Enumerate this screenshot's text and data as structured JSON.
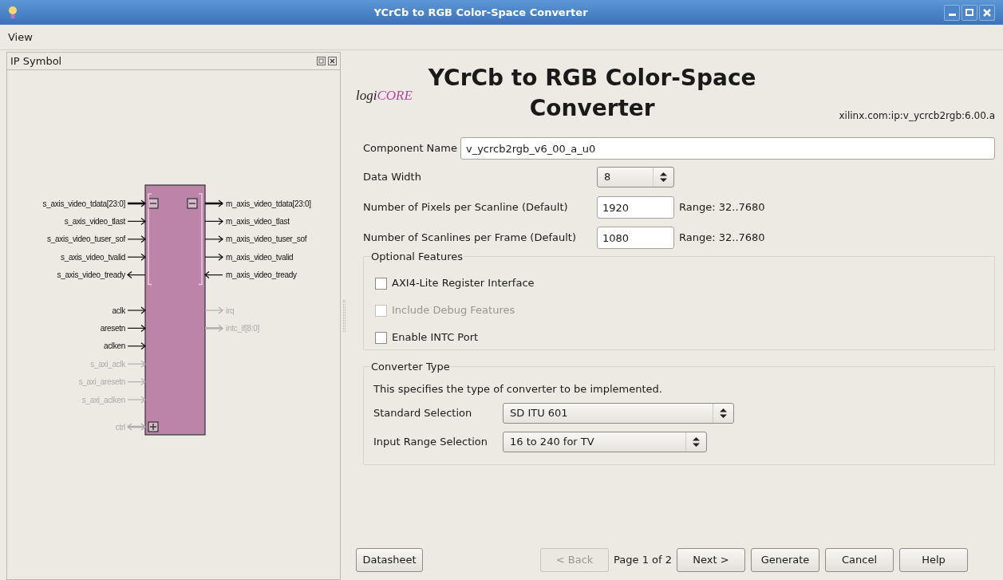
{
  "window": {
    "title": "YCrCb to RGB Color-Space Converter"
  },
  "menu": [
    {
      "label": "View"
    }
  ],
  "ip_symbol": {
    "title": "IP Symbol",
    "left_groups": [
      {
        "kind": "bus",
        "expanded": true,
        "pins": [
          {
            "name": "s_axis_video_tdata[23:0]",
            "outward": false,
            "bidirectional": false,
            "bus": true,
            "enabled": true
          },
          {
            "name": "s_axis_video_tlast",
            "outward": false,
            "bidirectional": false,
            "bus": false,
            "enabled": true
          },
          {
            "name": "s_axis_video_tuser_sof",
            "outward": false,
            "bidirectional": false,
            "bus": false,
            "enabled": true
          },
          {
            "name": "s_axis_video_tvalid",
            "outward": false,
            "bidirectional": false,
            "bus": false,
            "enabled": true
          },
          {
            "name": "s_axis_video_tready",
            "outward": true,
            "bidirectional": false,
            "bus": false,
            "enabled": true
          }
        ]
      },
      {
        "kind": "plain",
        "pins": [
          {
            "name": "aclk",
            "outward": false,
            "bidirectional": false,
            "bus": false,
            "enabled": true
          },
          {
            "name": "aresetn",
            "outward": false,
            "bidirectional": false,
            "bus": false,
            "enabled": true
          },
          {
            "name": "aclken",
            "outward": false,
            "bidirectional": false,
            "bus": false,
            "enabled": true
          },
          {
            "name": "s_axi_aclk",
            "outward": false,
            "bidirectional": false,
            "bus": false,
            "enabled": false
          },
          {
            "name": "s_axi_aresetn",
            "outward": false,
            "bidirectional": false,
            "bus": false,
            "enabled": false
          },
          {
            "name": "s_axi_aclken",
            "outward": false,
            "bidirectional": false,
            "bus": false,
            "enabled": false
          }
        ]
      },
      {
        "kind": "bus",
        "expanded": false,
        "pins": [
          {
            "name": "ctrl",
            "outward": false,
            "bidirectional": true,
            "bus": true,
            "enabled": false
          }
        ]
      }
    ],
    "right_groups": [
      {
        "kind": "bus",
        "expanded": true,
        "pins": [
          {
            "name": "m_axis_video_tdata[23:0]",
            "outward": true,
            "bidirectional": false,
            "bus": true,
            "enabled": true
          },
          {
            "name": "m_axis_video_tlast",
            "outward": true,
            "bidirectional": false,
            "bus": false,
            "enabled": true
          },
          {
            "name": "m_axis_video_tuser_sof",
            "outward": true,
            "bidirectional": false,
            "bus": false,
            "enabled": true
          },
          {
            "name": "m_axis_video_tvalid",
            "outward": true,
            "bidirectional": false,
            "bus": false,
            "enabled": true
          },
          {
            "name": "m_axis_video_tready",
            "outward": false,
            "bidirectional": false,
            "bus": false,
            "enabled": true
          }
        ]
      },
      {
        "kind": "plain",
        "pins": [
          {
            "name": "irq",
            "outward": true,
            "bidirectional": false,
            "bus": false,
            "enabled": false
          },
          {
            "name": "intc_if[8:0]",
            "outward": true,
            "bidirectional": false,
            "bus": true,
            "enabled": false
          }
        ]
      }
    ]
  },
  "header": {
    "logo_part_1": "logi",
    "logo_part_2": "CORE",
    "title_line_1": "YCrCb to RGB Color-Space",
    "title_line_2": "Converter",
    "vlnv": "xilinx.com:ip:v_ycrcb2rgb:6.00.a"
  },
  "component_name": {
    "label": "Component Name",
    "value": "v_ycrcb2rgb_v6_00_a_u0"
  },
  "fields": [
    {
      "kind": "select",
      "label": "Data Width",
      "value": "8"
    },
    {
      "kind": "number",
      "label": "Number of Pixels per Scanline (Default)",
      "value": "1920",
      "range": "Range: 32..7680"
    },
    {
      "kind": "number",
      "label": "Number of Scanlines per Frame (Default)",
      "value": "1080",
      "range": "Range: 32..7680"
    }
  ],
  "optional_features": {
    "title": "Optional Features",
    "options": [
      {
        "label": "AXI4-Lite Register Interface",
        "checked": false,
        "disabled": false
      },
      {
        "label": "Include Debug Features",
        "checked": false,
        "disabled": true
      },
      {
        "label": "Enable INTC Port",
        "checked": false,
        "disabled": false
      }
    ]
  },
  "converter_type": {
    "title": "Converter Type",
    "description": "This specifies the type of converter to be implemented.",
    "selects": [
      {
        "label": "Standard Selection",
        "value": "SD ITU 601"
      },
      {
        "label": "Input Range Selection",
        "value": "16 to 240 for TV"
      }
    ]
  },
  "footer": {
    "datasheet": {
      "label": "Datasheet",
      "disabled": false
    },
    "back": {
      "label": "< Back",
      "disabled": true
    },
    "page": "Page 1 of 2",
    "buttons": [
      {
        "label": "Next >",
        "disabled": false
      },
      {
        "label": "Generate",
        "disabled": false
      },
      {
        "label": "Cancel",
        "disabled": false
      },
      {
        "label": "Help",
        "disabled": false
      }
    ]
  }
}
